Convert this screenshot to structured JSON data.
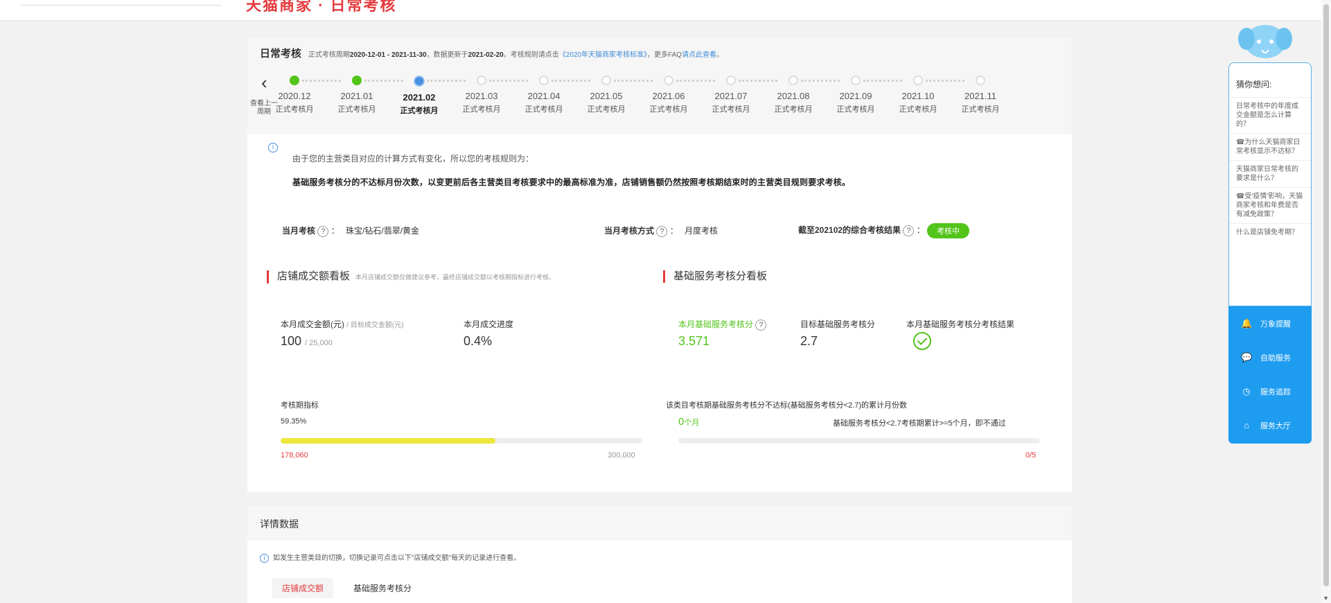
{
  "header": {
    "brand": "天猫商家 · 日常考核"
  },
  "title": {
    "main": "日常考核",
    "period_prefix": "正式考核周期",
    "period": "2020-12-01 - 2021-11-30",
    "updated_prefix": "，数据更新于",
    "updated": "2021-02-20",
    "rule_prefix": "。考核规则请点击",
    "rule_link": "《2020年天猫商家考核标准》",
    "faq_prefix": "，更多FAQ",
    "faq_link": "请点此查看",
    "faq_suffix": "。"
  },
  "timeline": {
    "prev_label": "查看上一周期",
    "months": [
      {
        "ym": "2020.12",
        "status": "正式考核月",
        "state": "done"
      },
      {
        "ym": "2021.01",
        "status": "正式考核月",
        "state": "done"
      },
      {
        "ym": "2021.02",
        "status": "正式考核月",
        "state": "current"
      },
      {
        "ym": "2021.03",
        "status": "正式考核月",
        "state": "future"
      },
      {
        "ym": "2021.04",
        "status": "正式考核月",
        "state": "future"
      },
      {
        "ym": "2021.05",
        "status": "正式考核月",
        "state": "future"
      },
      {
        "ym": "2021.06",
        "status": "正式考核月",
        "state": "future"
      },
      {
        "ym": "2021.07",
        "status": "正式考核月",
        "state": "future"
      },
      {
        "ym": "2021.08",
        "status": "正式考核月",
        "state": "future"
      },
      {
        "ym": "2021.09",
        "status": "正式考核月",
        "state": "future"
      },
      {
        "ym": "2021.10",
        "status": "正式考核月",
        "state": "future"
      },
      {
        "ym": "2021.11",
        "status": "正式考核月",
        "state": "future"
      }
    ]
  },
  "notice": {
    "line1": "由于您的主营类目对应的计算方式有变化，所以您的考核规则为：",
    "line2": "基础服务考核分的不达标月份次数，以变更前后各主营类目考核要求中的最高标准为准，店铺销售额仍然按照考核期结束时的主营类目规则要求考核。"
  },
  "summary": {
    "cat_label": "当月考核",
    "cat_value": "珠宝/钻石/翡翠/黄金",
    "method_label": "当月考核方式",
    "method_value": "月度考核",
    "result_label": "截至202102的综合考核结果",
    "result_badge": "考核中"
  },
  "left_panel": {
    "title": "店铺成交额看板",
    "subtitle": "本月店铺成交额仅做建议参考，最终店铺成交额以考核期指标进行考核。",
    "amount_label": "本月成交金额(元)",
    "amount_target_label": "/ 目标成交金额(元)",
    "amount": "100",
    "amount_target": "/ 25,000",
    "progress_label": "本月成交进度",
    "progress_value": "0.4%",
    "period_label": "考核期指标",
    "period_percent": "59.35%",
    "period_fraction": 0.5935,
    "period_current": "178,060",
    "period_target": "300,000"
  },
  "right_panel": {
    "title": "基础服务考核分看板",
    "score_label": "本月基础服务考核分",
    "score_value": "3.571",
    "target_label": "目标基础服务考核分",
    "target_value": "2.7",
    "result_label": "本月基础服务考核分考核结果",
    "fail_label": "该类目考核期基础服务考核分不达标(基础服务考核分<2.7)的累计月份数",
    "fail_count": "0",
    "fail_unit": "个月",
    "fail_rule": "基础服务考核分<2.7考核期累计>=5个月，即不通过",
    "fail_ratio": "0/5"
  },
  "details": {
    "title": "详情数据",
    "info": "如发生主营类目的切换，切换记录可点击以下\"店铺成交额\"每天的记录进行查看。",
    "tabs": [
      "店铺成交额",
      "基础服务考核分"
    ]
  },
  "helper": {
    "heading": "猜你想问:",
    "questions": [
      "日常考核中的年度成交金额是怎么计算的？",
      "☎为什么天猫商家日常考核显示不达标？",
      "天猫商家日常考核的要求是什么？",
      "☎受'疫情'影响，天猫商家考核和年费是否有减免政策？",
      "什么是店铺免考期？"
    ],
    "buttons": [
      {
        "icon": "bell-icon",
        "glyph": "🔔",
        "label": "万象提醒"
      },
      {
        "icon": "chat-icon",
        "glyph": "💬",
        "label": "自助服务"
      },
      {
        "icon": "clock-icon",
        "glyph": "◷",
        "label": "服务追踪"
      },
      {
        "icon": "home-icon",
        "glyph": "⌂",
        "label": "服务大厅"
      }
    ]
  },
  "colors": {
    "accent_red": "#e4393c",
    "green": "#52c41a",
    "blue": "#1e9cf0",
    "progress_yellow": "#ece73a"
  }
}
